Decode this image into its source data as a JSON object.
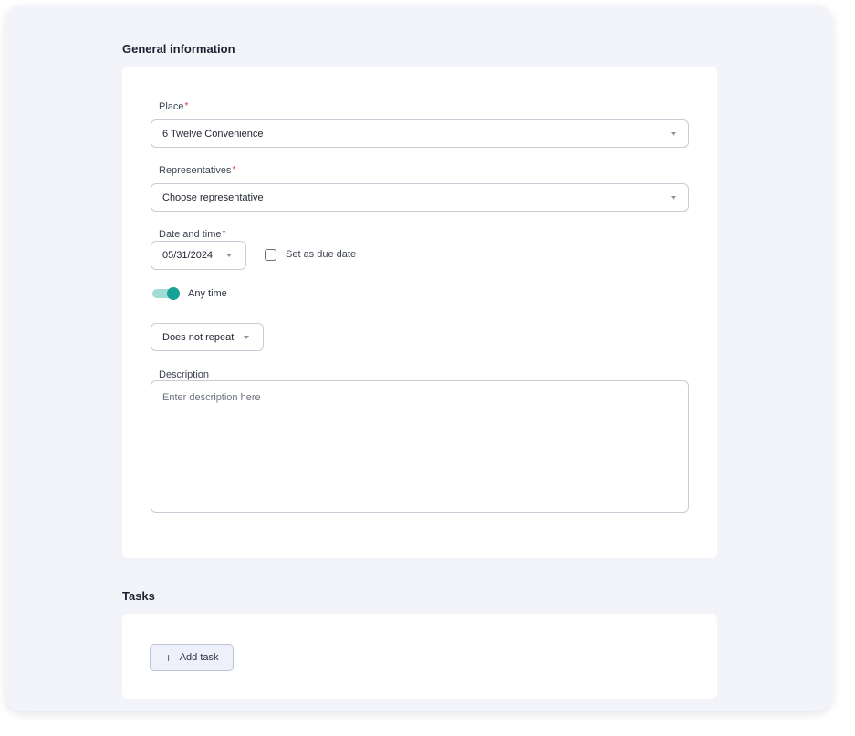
{
  "general": {
    "title": "General information",
    "place": {
      "label": "Place",
      "required_mark": "*",
      "value": "6 Twelve Convenience",
      "icon": "chevron-down-icon"
    },
    "representatives": {
      "label": "Representatives",
      "required_mark": "*",
      "value": "Choose representative",
      "icon": "chevron-down-icon"
    },
    "date_time": {
      "label": "Date and time",
      "required_mark": "*",
      "date_value": "05/31/2024",
      "icon": "chevron-down-icon"
    },
    "due_date": {
      "label": "Set as due date",
      "checked": false
    },
    "any_time": {
      "label": "Any time",
      "on": true,
      "color": "#17a296"
    },
    "repeat": {
      "value": "Does not repeat",
      "icon": "chevron-down-icon"
    },
    "description": {
      "label": "Description",
      "placeholder": "Enter description here"
    }
  },
  "tasks": {
    "title": "Tasks",
    "add_button": {
      "label": "Add task",
      "icon": "plus-icon"
    }
  }
}
